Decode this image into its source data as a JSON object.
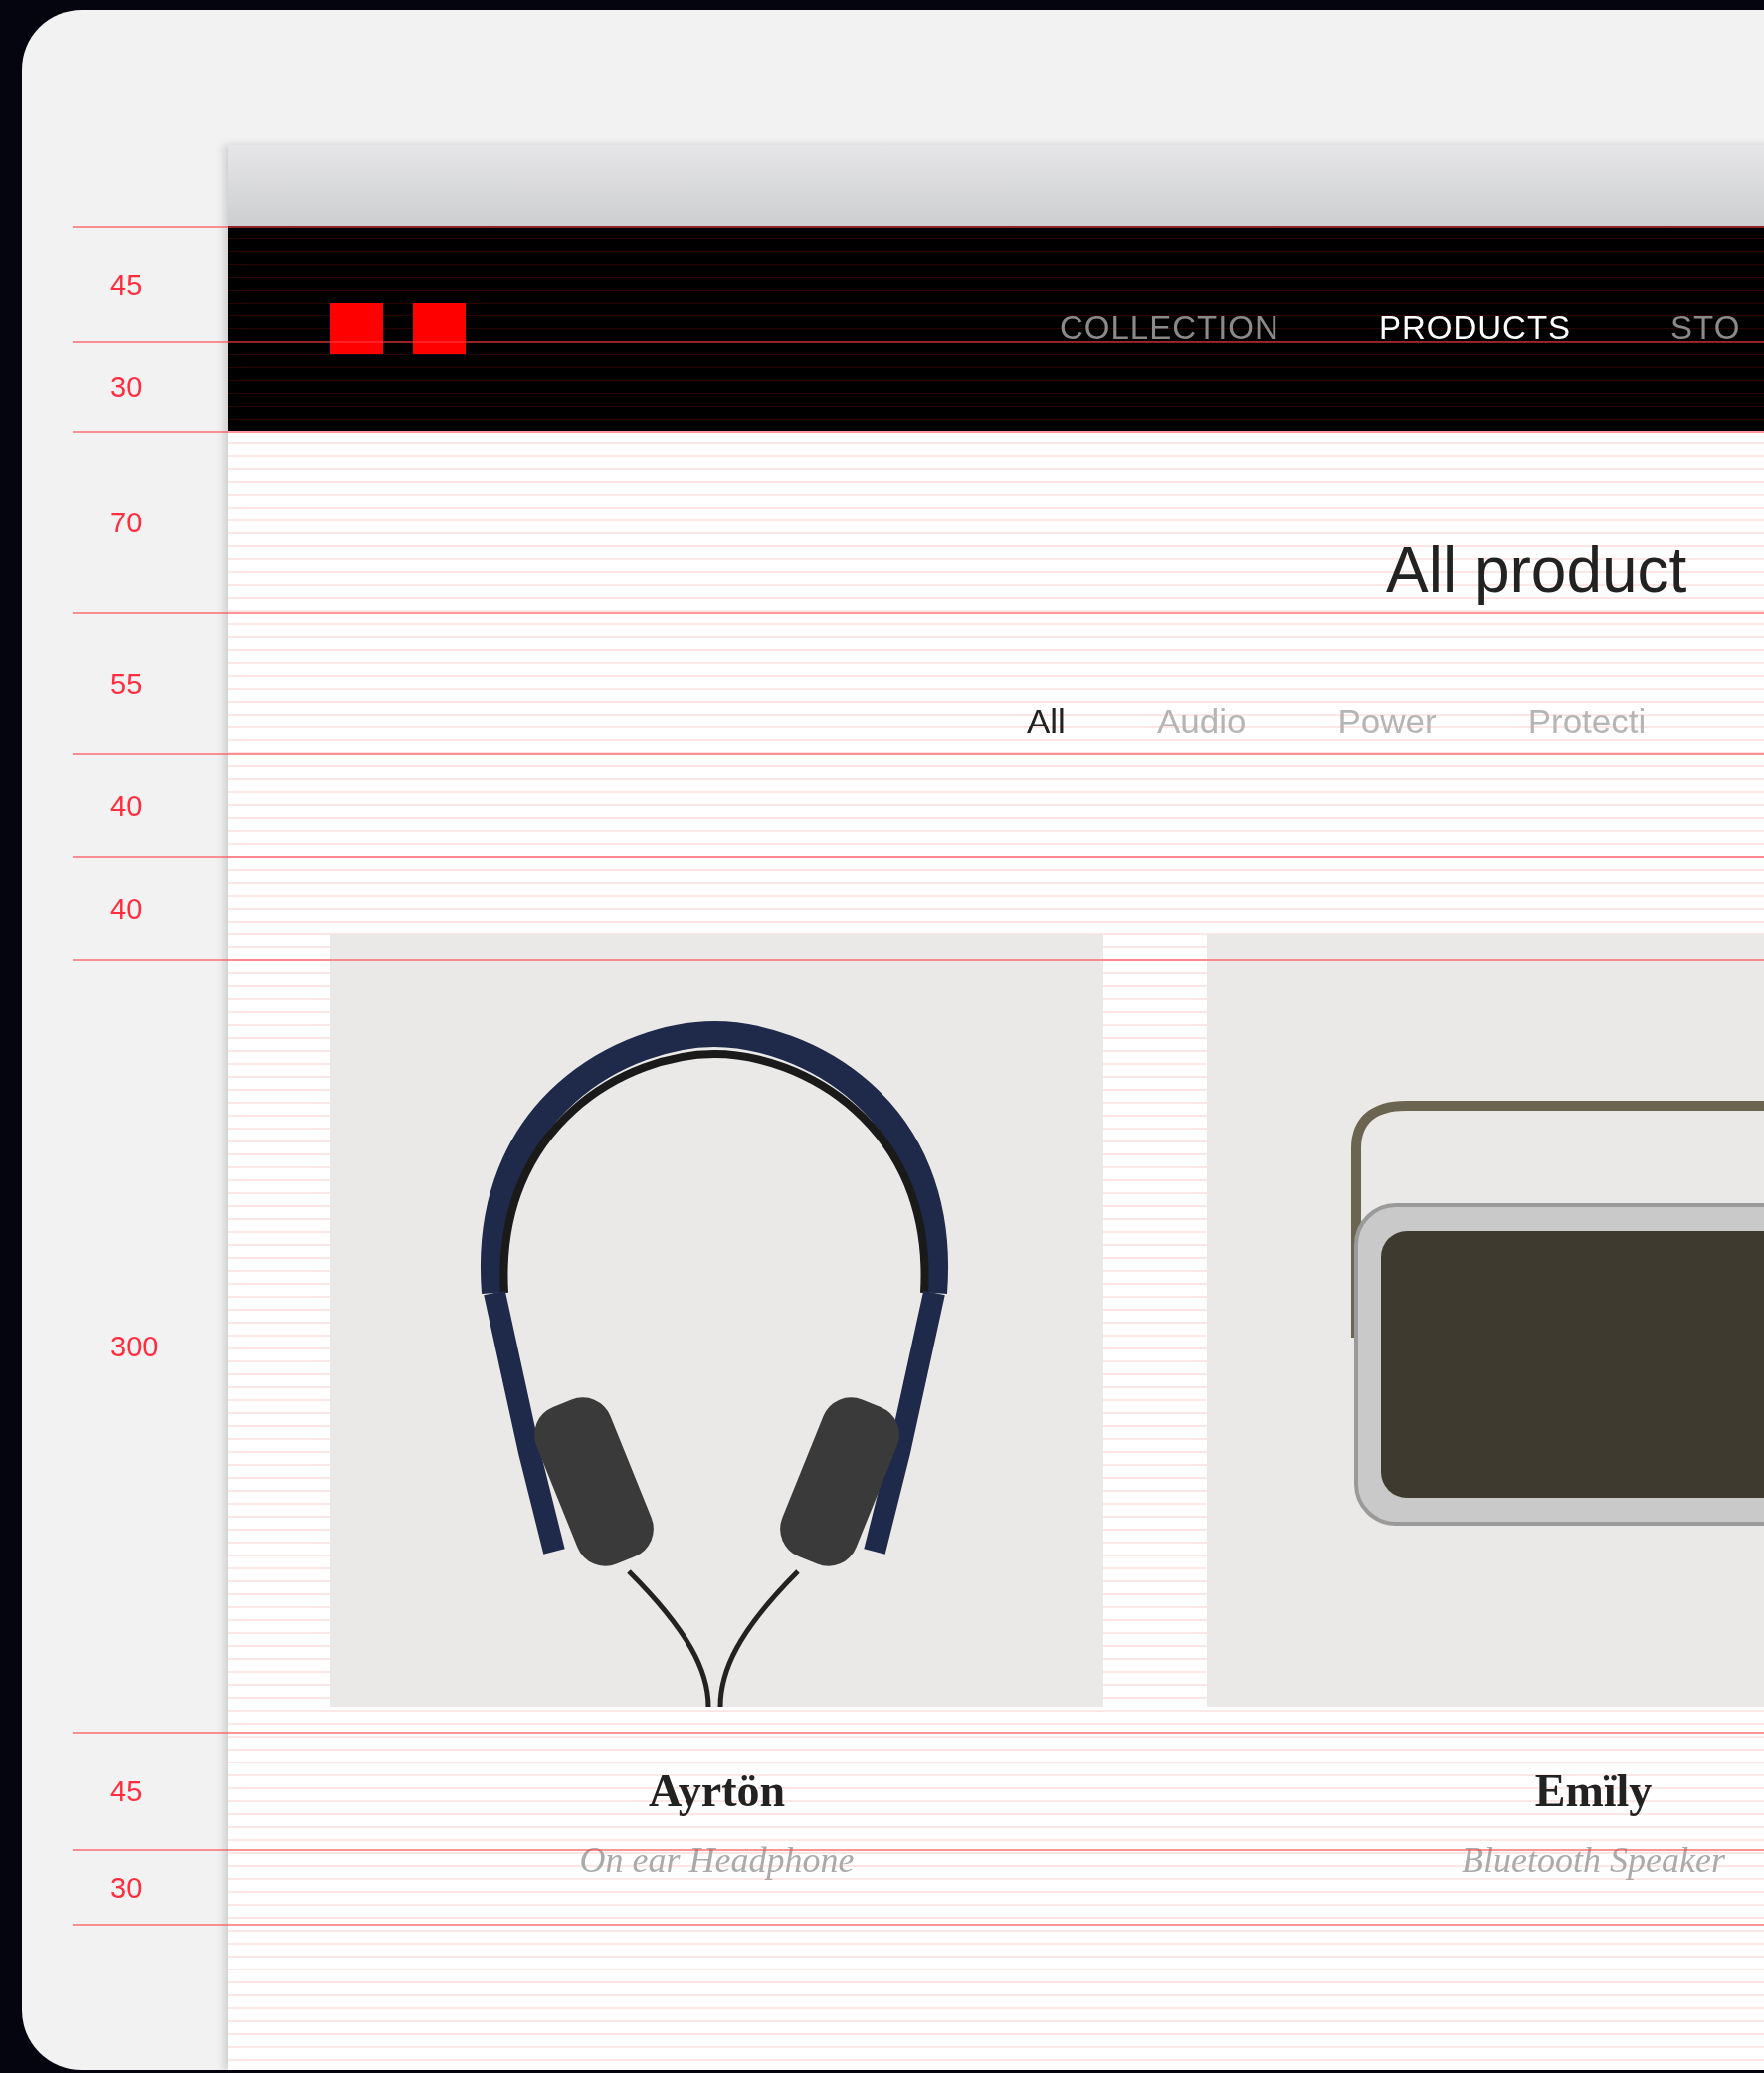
{
  "dimension_guides": [
    "45",
    "30",
    "70",
    "55",
    "40",
    "40",
    "300",
    "45",
    "30"
  ],
  "nav": {
    "items": [
      {
        "label": "COLLECTION",
        "selected": false
      },
      {
        "label": "PRODUCTS",
        "selected": true
      },
      {
        "label": "STO",
        "selected": false
      }
    ]
  },
  "page_title": "All product",
  "filters": [
    {
      "label": "All",
      "selected": true
    },
    {
      "label": "Audio",
      "selected": false
    },
    {
      "label": "Power",
      "selected": false
    },
    {
      "label": "Protecti",
      "selected": false
    }
  ],
  "products": [
    {
      "name": "Ayrtön",
      "subtitle": "On ear Headphone",
      "kind": "headphone"
    },
    {
      "name": "Emïly",
      "subtitle": "Bluetooth Speaker",
      "kind": "speaker"
    }
  ]
}
